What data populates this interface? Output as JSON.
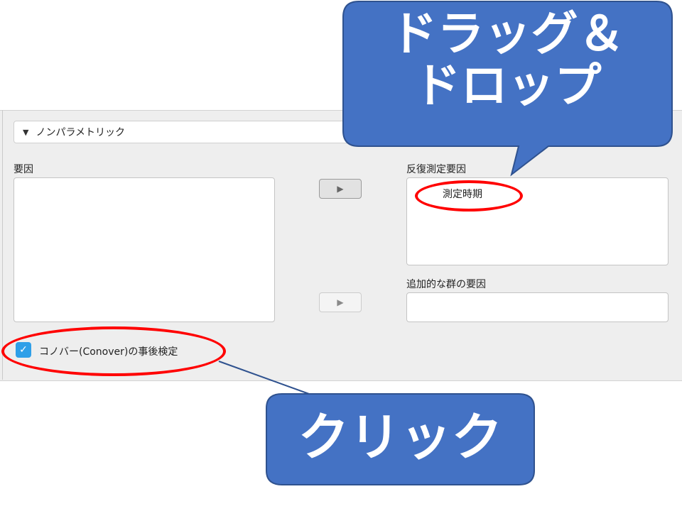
{
  "section": {
    "toggle_icon": "▼",
    "title": "ノンパラメトリック"
  },
  "left_list": {
    "label": "要因",
    "items": []
  },
  "buttons": {
    "move_glyph": "▶"
  },
  "repeated_factor": {
    "label": "反復測定要因",
    "items": [
      "測定時期"
    ]
  },
  "additional_factor": {
    "label": "追加的な群の要因",
    "items": []
  },
  "conover": {
    "checked": true,
    "check_glyph": "✓",
    "label": "コノバー(Conover)の事後検定"
  },
  "callouts": {
    "drag_drop_line1": "ドラッグ＆",
    "drag_drop_line2": "ドロップ",
    "click": "クリック"
  },
  "colors": {
    "callout_fill": "#4472c4",
    "annotation_red": "#ff0000",
    "checkbox_blue": "#2f9fe8"
  }
}
